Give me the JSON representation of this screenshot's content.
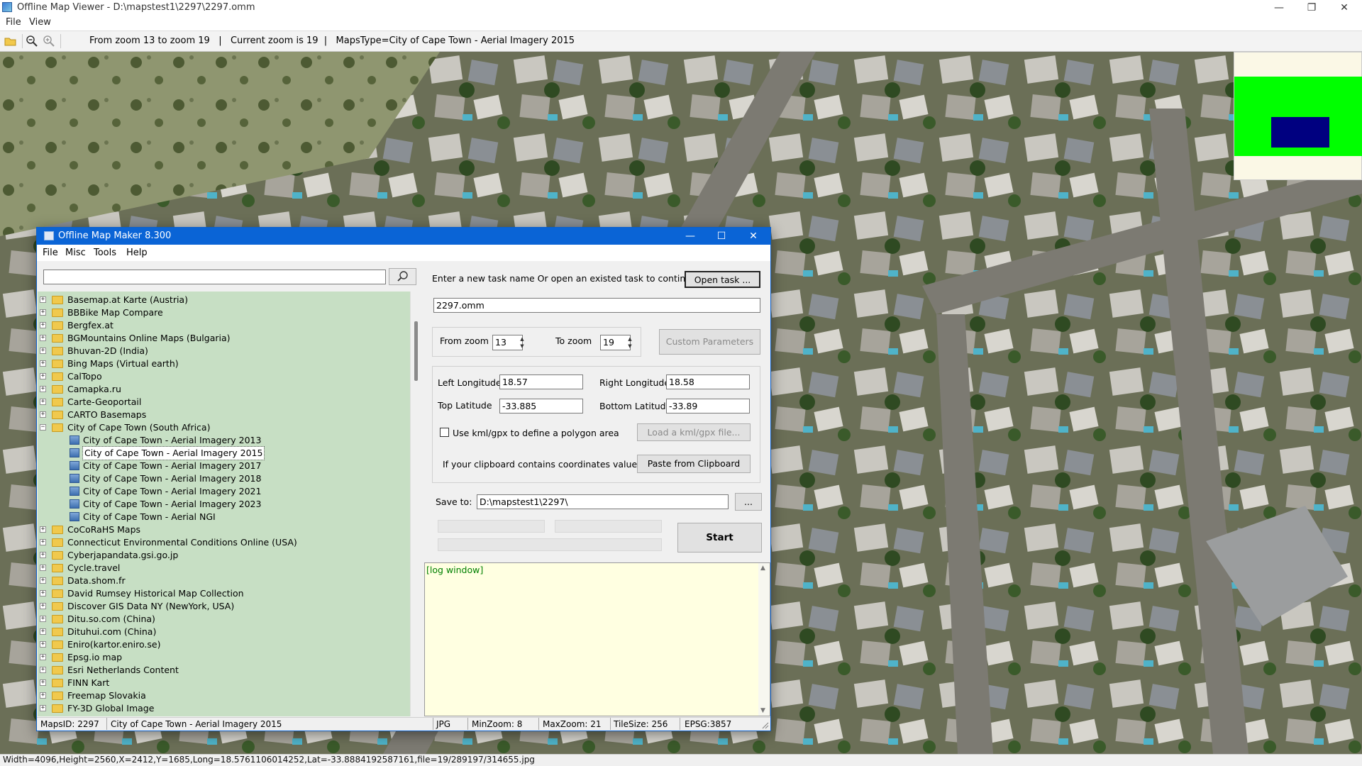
{
  "viewer": {
    "title": "Offline Map Viewer - D:\\mapstest1\\2297\\2297.omm",
    "menu": [
      "File",
      "View"
    ],
    "toolbar_info": "From zoom 13 to zoom 19   |   Current zoom is 19  |   MapsType=City of Cape Town - Aerial Imagery 2015",
    "status": "Width=4096,Height=2560,X=2412,Y=1685,Long=18.5761106014252,Lat=-33.8884192587161,file=19/289197/314655.jpg",
    "icons": [
      "open-folder-icon",
      "zoom-out-icon",
      "zoom-in-icon"
    ],
    "window_controls": {
      "minimize": "—",
      "maximize": "❐",
      "close": "✕"
    }
  },
  "minimap": {
    "colors": {
      "background": "#fbf8e6",
      "extent": "#00ff00",
      "view": "#000080"
    }
  },
  "dialog": {
    "title": "Offline Map Maker 8.300",
    "menu": [
      "File",
      "Misc",
      "Tools",
      "Help"
    ],
    "window_controls": {
      "minimize": "—",
      "maximize": "☐",
      "close": "✕"
    },
    "search": {
      "value": "",
      "placeholder": ""
    },
    "tree": [
      {
        "label": "Basemap.at Karte (Austria)",
        "type": "folder"
      },
      {
        "label": "BBBike Map Compare",
        "type": "folder"
      },
      {
        "label": "Bergfex.at",
        "type": "folder"
      },
      {
        "label": "BGMountains Online Maps (Bulgaria)",
        "type": "folder"
      },
      {
        "label": "Bhuvan-2D (India)",
        "type": "folder"
      },
      {
        "label": "Bing Maps (Virtual earth)",
        "type": "folder"
      },
      {
        "label": "CalTopo",
        "type": "folder"
      },
      {
        "label": "Camapka.ru",
        "type": "folder"
      },
      {
        "label": "Carte-Geoportail",
        "type": "folder"
      },
      {
        "label": "CARTO Basemaps",
        "type": "folder"
      },
      {
        "label": "City of Cape Town (South Africa)",
        "type": "folder-open"
      },
      {
        "label": "City of Cape Town - Aerial Imagery 2013",
        "type": "map"
      },
      {
        "label": "City of Cape Town - Aerial Imagery 2015",
        "type": "map",
        "selected": true
      },
      {
        "label": "City of Cape Town - Aerial Imagery 2017",
        "type": "map"
      },
      {
        "label": "City of Cape Town - Aerial Imagery 2018",
        "type": "map"
      },
      {
        "label": "City of Cape Town - Aerial Imagery 2021",
        "type": "map"
      },
      {
        "label": "City of Cape Town - Aerial Imagery 2023",
        "type": "map"
      },
      {
        "label": "City of Cape Town - Aerial NGI",
        "type": "map"
      },
      {
        "label": "CoCoRaHS Maps",
        "type": "folder"
      },
      {
        "label": "Connecticut Environmental Conditions Online (USA)",
        "type": "folder"
      },
      {
        "label": "Cyberjapandata.gsi.go.jp",
        "type": "folder"
      },
      {
        "label": "Cycle.travel",
        "type": "folder"
      },
      {
        "label": "Data.shom.fr",
        "type": "folder"
      },
      {
        "label": "David Rumsey Historical Map Collection",
        "type": "folder"
      },
      {
        "label": "Discover GIS Data NY (NewYork, USA)",
        "type": "folder"
      },
      {
        "label": "Ditu.so.com (China)",
        "type": "folder"
      },
      {
        "label": "Dituhui.com (China)",
        "type": "folder"
      },
      {
        "label": "Eniro(kartor.eniro.se)",
        "type": "folder"
      },
      {
        "label": "Epsg.io map",
        "type": "folder"
      },
      {
        "label": "Esri Netherlands Content",
        "type": "folder"
      },
      {
        "label": "FINN Kart",
        "type": "folder"
      },
      {
        "label": "Freemap Slovakia",
        "type": "folder"
      },
      {
        "label": "FY-3D Global Image",
        "type": "folder"
      }
    ],
    "task_prompt": "Enter a new task name Or open an existed task to continue:",
    "open_task_label": "Open task ...",
    "task_name": "2297.omm",
    "from_zoom_label": "From zoom",
    "from_zoom": "13",
    "to_zoom_label": "To zoom",
    "to_zoom": "19",
    "custom_params_label": "Custom Parameters",
    "left_lon_label": "Left Longitude",
    "left_lon": "18.57",
    "right_lon_label": "Right Longitude",
    "right_lon": "18.58",
    "top_lat_label": "Top Latitude",
    "top_lat": "-33.885",
    "bottom_lat_label": "Bottom Latitude",
    "bottom_lat": "-33.89",
    "kml_label": "Use kml/gpx to define a polygon area",
    "kml_checked": false,
    "load_kml_label": "Load a kml/gpx file...",
    "clipboard_label": "If your clipboard contains coordinates values:",
    "paste_label": "Paste from Clipboard",
    "save_to_label": "Save to:",
    "save_to": "D:\\mapstest1\\2297\\",
    "browse_label": "...",
    "start_label": "Start",
    "log_text": "[log window]",
    "status": {
      "maps_id": "MapsID: 2297",
      "map_name": "City of Cape Town - Aerial Imagery 2015",
      "format": "JPG",
      "min_zoom": "MinZoom: 8",
      "max_zoom": "MaxZoom: 21",
      "tile_size": "TileSize: 256",
      "epsg": "EPSG:3857"
    }
  }
}
